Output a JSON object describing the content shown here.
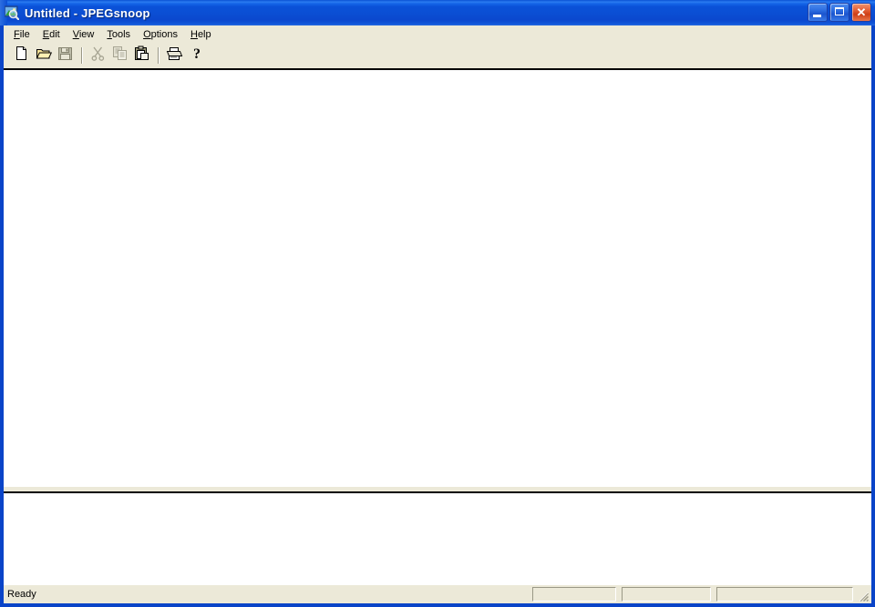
{
  "window": {
    "title": "Untitled - JPEGsnoop",
    "icon": "jpegsnoop-app-icon",
    "controls": {
      "minimize": "Minimize",
      "maximize": "Maximize",
      "close": "Close",
      "close_glyph": "✕"
    },
    "colors": {
      "titlebar_blue": "#0B4FD4",
      "frame_blue": "#0A44C8",
      "face": "#ECE9D8",
      "client_white": "#FFFFFF",
      "close_red": "#CE3E16"
    }
  },
  "menubar": {
    "items": [
      {
        "label": "File",
        "accel_index": 0
      },
      {
        "label": "Edit",
        "accel_index": 0
      },
      {
        "label": "View",
        "accel_index": 0
      },
      {
        "label": "Tools",
        "accel_index": 0
      },
      {
        "label": "Options",
        "accel_index": 0
      },
      {
        "label": "Help",
        "accel_index": 0
      }
    ]
  },
  "toolbar": {
    "buttons": [
      {
        "name": "new-icon",
        "label": "New",
        "enabled": true
      },
      {
        "name": "open-icon",
        "label": "Open",
        "enabled": true
      },
      {
        "name": "save-icon",
        "label": "Save",
        "enabled": false
      },
      {
        "name": "separator",
        "label": "",
        "enabled": false
      },
      {
        "name": "cut-icon",
        "label": "Cut",
        "enabled": false
      },
      {
        "name": "copy-icon",
        "label": "Copy",
        "enabled": false
      },
      {
        "name": "paste-icon",
        "label": "Paste",
        "enabled": true
      },
      {
        "name": "separator",
        "label": "",
        "enabled": false
      },
      {
        "name": "print-icon",
        "label": "Print",
        "enabled": true
      },
      {
        "name": "help-icon",
        "label": "About",
        "enabled": true
      }
    ]
  },
  "panes": {
    "top": {
      "content": ""
    },
    "bottom": {
      "content": ""
    }
  },
  "statusbar": {
    "message": "Ready",
    "panels": [
      "",
      "",
      ""
    ]
  }
}
